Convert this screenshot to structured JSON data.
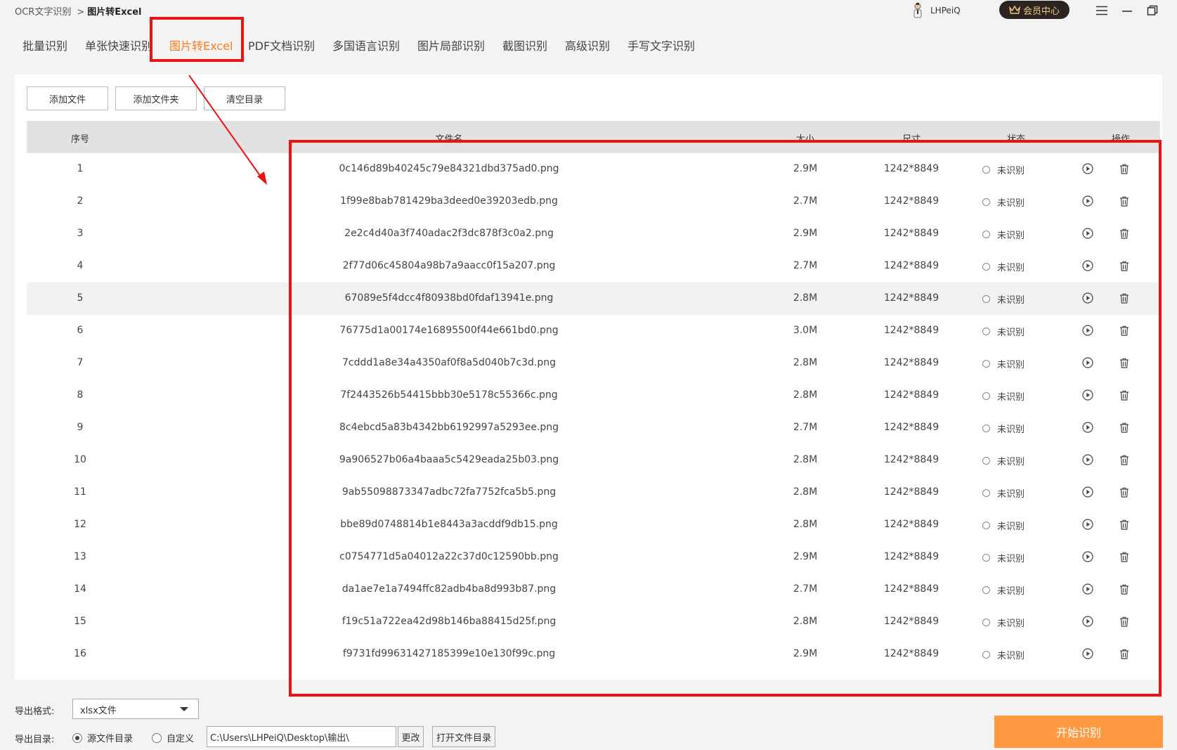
{
  "breadcrumb": {
    "root": "OCR文字识别",
    "sep": ">",
    "current": "图片转Excel"
  },
  "user": {
    "name": "LHPeiQ"
  },
  "vip_label": "会员中心",
  "tabs": [
    "批量识别",
    "单张快速识别",
    "图片转Excel",
    "PDF文档识别",
    "多国语言识别",
    "图片局部识别",
    "截图识别",
    "高级识别",
    "手写文字识别"
  ],
  "active_tab": "图片转Excel",
  "toolbar": {
    "add_file": "添加文件",
    "add_folder": "添加文件夹",
    "clear": "清空目录"
  },
  "columns": [
    "序号",
    "文件名",
    "大小",
    "尺寸",
    "状态",
    "操作"
  ],
  "rows": [
    {
      "no": "1",
      "name": "0c146d89b40245c79e84321dbd375ad0.png",
      "size": "2.9M",
      "dim": "1242*8849",
      "status": "未识别"
    },
    {
      "no": "2",
      "name": "1f99e8bab781429ba3deed0e39203edb.png",
      "size": "2.7M",
      "dim": "1242*8849",
      "status": "未识别"
    },
    {
      "no": "3",
      "name": "2e2c4d40a3f740adac2f3dc878f3c0a2.png",
      "size": "2.9M",
      "dim": "1242*8849",
      "status": "未识别"
    },
    {
      "no": "4",
      "name": "2f77d06c45804a98b7a9aacc0f15a207.png",
      "size": "2.7M",
      "dim": "1242*8849",
      "status": "未识别"
    },
    {
      "no": "5",
      "name": "67089e5f4dcc4f80938bd0fdaf13941e.png",
      "size": "2.8M",
      "dim": "1242*8849",
      "status": "未识别"
    },
    {
      "no": "6",
      "name": "76775d1a00174e16895500f44e661bd0.png",
      "size": "3.0M",
      "dim": "1242*8849",
      "status": "未识别"
    },
    {
      "no": "7",
      "name": "7cddd1a8e34a4350af0f8a5d040b7c3d.png",
      "size": "2.8M",
      "dim": "1242*8849",
      "status": "未识别"
    },
    {
      "no": "8",
      "name": "7f2443526b54415bbb30e5178c55366c.png",
      "size": "2.8M",
      "dim": "1242*8849",
      "status": "未识别"
    },
    {
      "no": "9",
      "name": "8c4ebcd5a83b4342bb6192997a5293ee.png",
      "size": "2.7M",
      "dim": "1242*8849",
      "status": "未识别"
    },
    {
      "no": "10",
      "name": "9a906527b06a4baaa5c5429eada25b03.png",
      "size": "2.8M",
      "dim": "1242*8849",
      "status": "未识别"
    },
    {
      "no": "11",
      "name": "9ab55098873347adbc72fa7752fca5b5.png",
      "size": "2.8M",
      "dim": "1242*8849",
      "status": "未识别"
    },
    {
      "no": "12",
      "name": "bbe89d0748814b1e8443a3acddf9db15.png",
      "size": "2.8M",
      "dim": "1242*8849",
      "status": "未识别"
    },
    {
      "no": "13",
      "name": "c0754771d5a04012a22c37d0c12590bb.png",
      "size": "2.9M",
      "dim": "1242*8849",
      "status": "未识别"
    },
    {
      "no": "14",
      "name": "da1ae7e1a7494ffc82adb4ba8d993b87.png",
      "size": "2.7M",
      "dim": "1242*8849",
      "status": "未识别"
    },
    {
      "no": "15",
      "name": "f19c51a722ea42d98b146ba88415d25f.png",
      "size": "2.8M",
      "dim": "1242*8849",
      "status": "未识别"
    },
    {
      "no": "16",
      "name": "f9731fd99631427185399e10e130f99c.png",
      "size": "2.9M",
      "dim": "1242*8849",
      "status": "未识别"
    }
  ],
  "hovered_row": "5",
  "export": {
    "format_label": "导出格式:",
    "format_value": "xlsx文件",
    "dir_label": "导出目录:",
    "dir_option_source": "源文件目录",
    "dir_option_custom": "自定义",
    "dir_selected": "源文件目录",
    "path": "C:\\Users\\LHPeiQ\\Desktop\\输出\\",
    "change_label": "更改",
    "open_dir_label": "打开文件目录"
  },
  "start_label": "开始识别",
  "colors": {
    "accent": "#ff7a1a",
    "start_button": "#ff9a42",
    "annotation": "#ee1111",
    "vip_bg": "#2b2521",
    "vip_text": "#f5c77e"
  },
  "icons": [
    "user-avatar-icon",
    "crown-icon",
    "menu-icon",
    "minimize-icon",
    "maximize-icon",
    "play-icon",
    "trash-icon"
  ]
}
